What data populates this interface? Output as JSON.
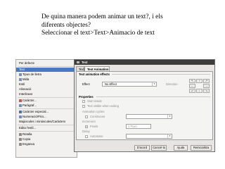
{
  "question": {
    "line1": "De quina manera podem animar un text?, i els",
    "line2": "diferents objectes?",
    "line3": "Seleccionar el text>Text>Animacio de text"
  },
  "menu": {
    "items": [
      {
        "label": "Per defecte",
        "submenu": false
      },
      {
        "label": "Text",
        "submenu": true
      },
      {
        "label": "Tipus de lletra",
        "submenu": true
      },
      {
        "label": "Mida",
        "submenu": true
      },
      {
        "label": "Estil",
        "submenu": true
      },
      {
        "label": "Alineació",
        "submenu": true
      },
      {
        "label": "Interlineat",
        "submenu": true
      },
      {
        "label": "Caràcter...",
        "submenu": false
      },
      {
        "label": "Paràgraf...",
        "submenu": false
      },
      {
        "label": "Caràcter especial...",
        "submenu": false
      },
      {
        "label": "Numeració/Pics...",
        "submenu": false
      },
      {
        "label": "Majúscules i minúscules/Caràcters",
        "submenu": true
      },
      {
        "label": "Edita l'estil...",
        "submenu": false
      },
      {
        "label": "Retalla",
        "submenu": false
      },
      {
        "label": "Copia",
        "submenu": false
      },
      {
        "label": "Enganxa",
        "submenu": false
      }
    ]
  },
  "dialog": {
    "title": "Text",
    "tabs": [
      "Text",
      "Text Animation"
    ],
    "section_effects": "Text animation effects",
    "effect_label": "Effect",
    "effect_value": "No Effect",
    "direction_label": "Direction",
    "section_properties": "Properties",
    "start_inside": "Start inside",
    "text_visible": "Text visible when exiting",
    "animation_cycles": "Animation cycles",
    "continuous": "Continuous",
    "increment": "Increment",
    "pixels": "Pixels",
    "pixels_value": "1 Pixel",
    "delay": "Delay",
    "automatic": "Automatic",
    "buttons": [
      "D'acord",
      "Cancel·la",
      "Ajuda",
      "Reinicialitza"
    ]
  },
  "colors": {
    "highlight": "#4a78c2",
    "titlebar": "#3d3c3a"
  }
}
